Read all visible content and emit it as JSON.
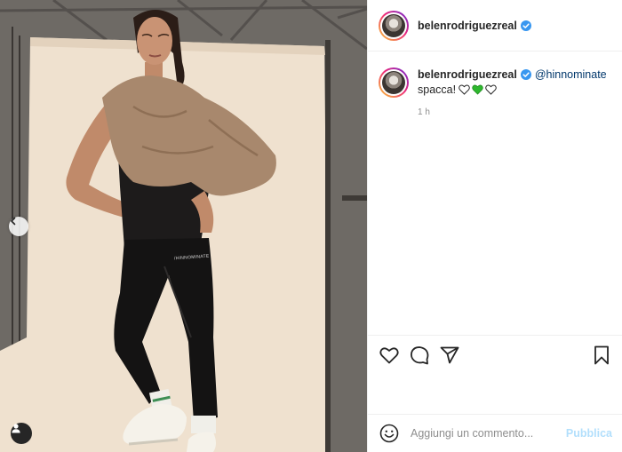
{
  "post": {
    "username": "belenrodriguezreal",
    "verified": true
  },
  "comment": {
    "username": "belenrodriguezreal",
    "mention": "@hinnominate",
    "text": "spacca!",
    "time": "1 h",
    "hearts": [
      "white-heart",
      "green-heart",
      "white-heart"
    ]
  },
  "photo": {
    "leggings_print": "/HINNOMINATE"
  },
  "add_comment": {
    "placeholder": "Aggiungi un commento...",
    "publish_label": "Pubblica"
  },
  "colors": {
    "accent": "#0095f6",
    "verified": "#3897f0",
    "publish_disabled": "#b2dffc",
    "mention": "#00376b",
    "secondary_text": "#8e8e8e"
  },
  "icons": {
    "like": "heart-outline-icon",
    "comment": "comment-bubble-icon",
    "share": "paper-plane-icon",
    "save": "bookmark-icon",
    "emoji": "emoji-smile-icon",
    "carousel_prev": "chevron-left-icon",
    "tagged_users": "user-tag-icon"
  }
}
